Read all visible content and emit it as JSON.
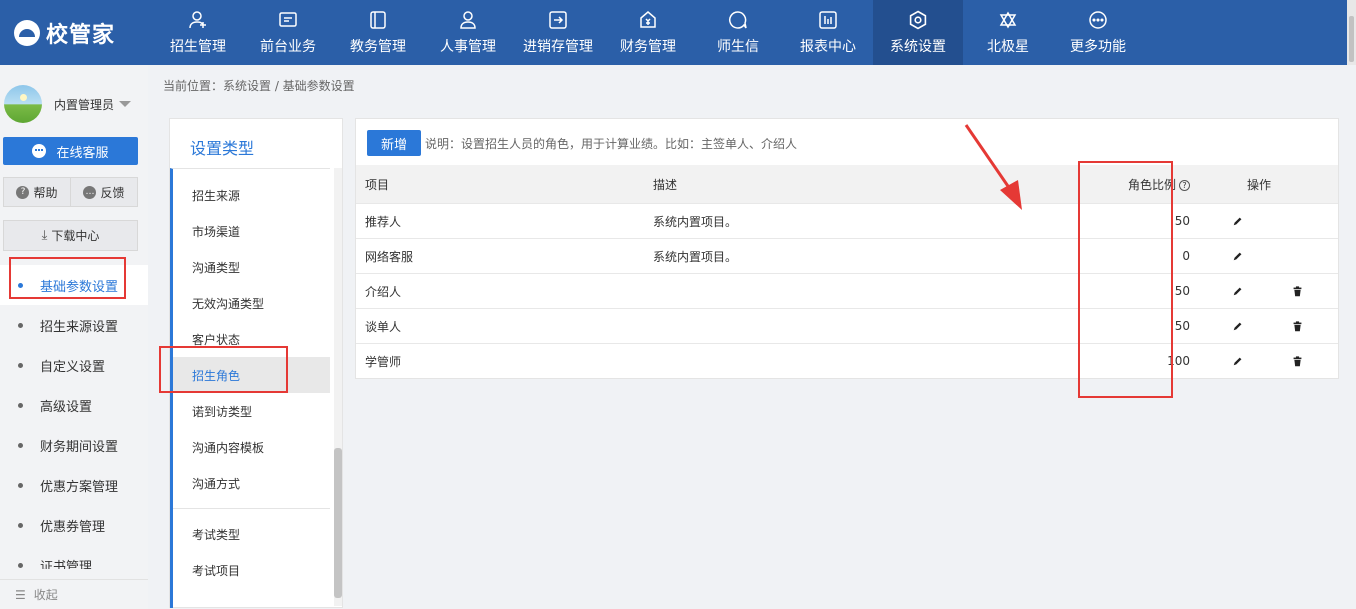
{
  "app": {
    "logo_text": "校管家"
  },
  "nav": [
    {
      "label": "招生管理",
      "icon": "person-add-icon"
    },
    {
      "label": "前台业务",
      "icon": "monitor-icon"
    },
    {
      "label": "教务管理",
      "icon": "book-icon"
    },
    {
      "label": "人事管理",
      "icon": "person-icon"
    },
    {
      "label": "进销存管理",
      "icon": "box-arrow-icon"
    },
    {
      "label": "财务管理",
      "icon": "money-bag-icon"
    },
    {
      "label": "师生信",
      "icon": "chat-icon"
    },
    {
      "label": "报表中心",
      "icon": "bar-chart-icon"
    },
    {
      "label": "系统设置",
      "icon": "gear-icon",
      "active": true
    },
    {
      "label": "北极星",
      "icon": "star-icon"
    },
    {
      "label": "更多功能",
      "icon": "more-icon"
    }
  ],
  "sidebar": {
    "user_name": "内置管理员",
    "online_service": "在线客服",
    "help": "帮助",
    "feedback": "反馈",
    "download_center": "下载中心",
    "menu": [
      {
        "label": "基础参数设置",
        "active": true
      },
      {
        "label": "招生来源设置"
      },
      {
        "label": "自定义设置"
      },
      {
        "label": "高级设置"
      },
      {
        "label": "财务期间设置"
      },
      {
        "label": "优惠方案管理"
      },
      {
        "label": "优惠券管理"
      },
      {
        "label": "证书管理"
      }
    ],
    "collapse": "收起"
  },
  "breadcrumb": "当前位置：系统设置 / 基础参数设置",
  "type_panel": {
    "title": "设置类型",
    "items": [
      "招生来源",
      "市场渠道",
      "沟通类型",
      "无效沟通类型",
      "客户状态",
      "招生角色",
      "诺到访类型",
      "沟通内容模板",
      "沟通方式"
    ],
    "items_group2": [
      "考试类型",
      "考试项目"
    ],
    "active": "招生角色"
  },
  "main": {
    "add_button": "新增",
    "description": "说明：设置招生人员的角色，用于计算业绩。比如：主签单人、介绍人",
    "columns": {
      "item": "项目",
      "desc": "描述",
      "ratio": "角色比例",
      "op": "操作"
    },
    "rows": [
      {
        "item": "推荐人",
        "desc": "系统内置项目。",
        "ratio": "50",
        "deletable": false
      },
      {
        "item": "网络客服",
        "desc": "系统内置项目。",
        "ratio": "0",
        "deletable": false
      },
      {
        "item": "介绍人",
        "desc": "",
        "ratio": "50",
        "deletable": true
      },
      {
        "item": "谈单人",
        "desc": "",
        "ratio": "50",
        "deletable": true
      },
      {
        "item": "学管师",
        "desc": "",
        "ratio": "100",
        "deletable": true
      }
    ]
  },
  "colors": {
    "brand": "#2b5fa8",
    "accent": "#2b78d8",
    "annotation": "#e53935"
  }
}
